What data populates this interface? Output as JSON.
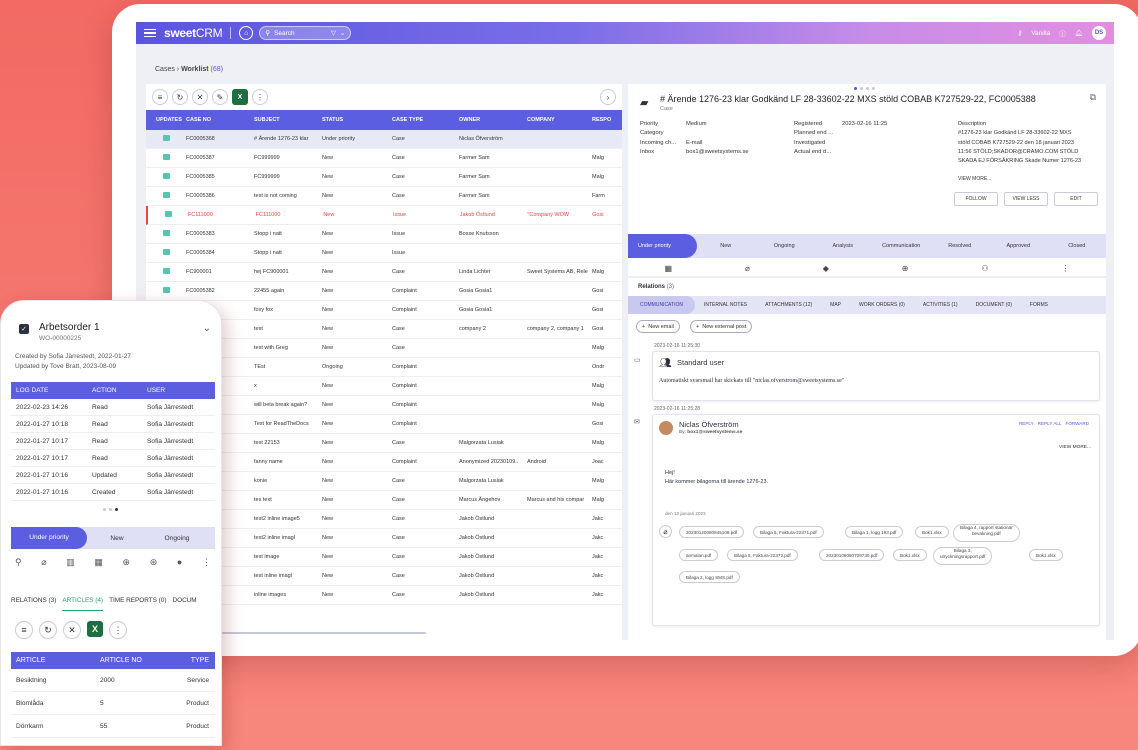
{
  "topbar": {
    "logo_bold": "sweet",
    "logo_light": "CRM",
    "search_placeholder": "Search",
    "user_name": "Vanilla",
    "avatar_initials": "DS"
  },
  "breadcrumb": {
    "root": "Cases",
    "current": "Worklist",
    "count": "(68)"
  },
  "list": {
    "columns": [
      "UPDATES",
      "CASE NO",
      "SUBJECT",
      "STATUS",
      "CASE TYPE",
      "OWNER",
      "COMPANY",
      "RESPO"
    ],
    "rows": [
      {
        "case": "FC0005368",
        "subject": "# Ärende 1276-23 klar",
        "status": "Under priority",
        "type": "Case",
        "owner": "Niclas Öfverström",
        "company": "",
        "resp": ""
      },
      {
        "case": "FC0005387",
        "subject": "FC999999",
        "status": "New",
        "type": "Case",
        "owner": "Farmer Sam",
        "company": "",
        "resp": "Malg"
      },
      {
        "case": "FC0005385",
        "subject": "FC999999",
        "status": "New",
        "type": "Case",
        "owner": "Farmer Sam",
        "company": "",
        "resp": "Malg"
      },
      {
        "case": "FC0005386",
        "subject": "test is not coming",
        "status": "New",
        "type": "Case",
        "owner": "Farmer Sam",
        "company": "",
        "resp": "Farm"
      },
      {
        "case": "FC111000",
        "subject": "FC111000",
        "status": "New",
        "type": "Issue",
        "owner": "Jakob Östlund",
        "company": "\"Company WOW",
        "resp": "Gosi"
      },
      {
        "case": "FC0005383",
        "subject": "Stopp i natt",
        "status": "New",
        "type": "Issue",
        "owner": "Bosse Knutsson",
        "company": "",
        "resp": ""
      },
      {
        "case": "FC0005384",
        "subject": "Stopp i natt",
        "status": "New",
        "type": "Issue",
        "owner": "",
        "company": "",
        "resp": ""
      },
      {
        "case": "FC900001",
        "subject": "hej FC900001",
        "status": "New",
        "type": "Case",
        "owner": "Linda Lichter",
        "company": "Sweet Systems AB, Rele",
        "resp": "Malg"
      },
      {
        "case": "FC0005382",
        "subject": "22455 again",
        "status": "New",
        "type": "Complaint",
        "owner": "Gosia Gosia1",
        "company": "",
        "resp": "Gosi"
      },
      {
        "case": "",
        "subject": "foxy fox",
        "status": "New",
        "type": "Complaint",
        "owner": "Gosia Gosia1",
        "company": "",
        "resp": "Gosi"
      },
      {
        "case": "",
        "subject": "test",
        "status": "New",
        "type": "Case",
        "owner": "company 2",
        "company": "company 2, company 1",
        "resp": "Gosi"
      },
      {
        "case": "",
        "subject": "test with Greg",
        "status": "New",
        "type": "Case",
        "owner": "",
        "company": "",
        "resp": "Malg"
      },
      {
        "case": "",
        "subject": "TEst",
        "status": "Ongoing",
        "type": "Complaint",
        "owner": "",
        "company": "",
        "resp": "Ondr"
      },
      {
        "case": "",
        "subject": "x",
        "status": "New",
        "type": "Complaint",
        "owner": "",
        "company": "",
        "resp": "Malg"
      },
      {
        "case": "",
        "subject": "will beta break again?",
        "status": "New",
        "type": "Complaint",
        "owner": "",
        "company": "",
        "resp": "Malg"
      },
      {
        "case": "",
        "subject": "Test for ReadTheDocs",
        "status": "New",
        "type": "Complaint",
        "owner": "",
        "company": "",
        "resp": "Gosi"
      },
      {
        "case": "",
        "subject": "test 22153",
        "status": "New",
        "type": "Case",
        "owner": "Malgorzata Lusiak",
        "company": "",
        "resp": "Malg"
      },
      {
        "case": "",
        "subject": "fanny name",
        "status": "New",
        "type": "Complaint",
        "owner": "Anonymized 20230109..",
        "company": "Android",
        "resp": "Joac"
      },
      {
        "case": "",
        "subject": "konie",
        "status": "New",
        "type": "Case",
        "owner": "Malgorzata Lusiak",
        "company": "",
        "resp": "Malg"
      },
      {
        "case": "",
        "subject": "tes text",
        "status": "New",
        "type": "Case",
        "owner": "Marcus Ängehov",
        "company": "Marcus and his compar",
        "resp": "Malg"
      },
      {
        "case": "",
        "subject": "test2 inline image5",
        "status": "New",
        "type": "Case",
        "owner": "Jakob Östlund",
        "company": "",
        "resp": "Jakc"
      },
      {
        "case": "",
        "subject": "test2 inline imagl",
        "status": "New",
        "type": "Case",
        "owner": "Jakob Östlund",
        "company": "",
        "resp": "Jakc"
      },
      {
        "case": "",
        "subject": "test image",
        "status": "New",
        "type": "Case",
        "owner": "Jakob Östlund",
        "company": "",
        "resp": "Jakc"
      },
      {
        "case": "",
        "subject": "test inline imagl",
        "status": "New",
        "type": "Case",
        "owner": "Jakob Östlund",
        "company": "",
        "resp": "Jakc"
      },
      {
        "case": "",
        "subject": "inline images",
        "status": "New",
        "type": "Case",
        "owner": "Jakob Östlund",
        "company": "",
        "resp": "Jakc"
      }
    ]
  },
  "detail": {
    "title": "# Ärende 1276-23 klar Godkänd LF 28-33602-22 MXS stöld COBAB K727529-22, FC0005388",
    "subtitle": "Case",
    "fields_left": [
      [
        "Priority",
        "Medium"
      ],
      [
        "Category",
        ""
      ],
      [
        "Incoming ch...",
        "E-mail"
      ],
      [
        "Inbox",
        "box1@sweetsystems.se"
      ]
    ],
    "fields_mid": [
      [
        "Registered",
        "2023-02-16 11:25"
      ],
      [
        "Planned end ...",
        ""
      ],
      [
        "Investigated",
        ""
      ],
      [
        "Actual end d...",
        ""
      ]
    ],
    "description_label": "Description",
    "description": [
      "#1276-23 klar Godkänd LF 28-33602-22 MXS",
      "stöld COBAB K727529-22 den 18 januari 2023",
      "11:56 STÖLD;SKADOR@CRAMO.COM      STÖLD",
      "SKADA  EJ FÖRSÄKRING  Skade Numer 1276-23"
    ],
    "view_more": "VIEW MORE...",
    "buttons": {
      "follow": "FOLLOW",
      "view_less": "VIEW LESS",
      "edit": "EDIT"
    },
    "stages": [
      "Under priority",
      "New",
      "Ongoing",
      "Analysis",
      "Communication",
      "Resolved",
      "Approved",
      "Closed"
    ]
  },
  "relations": {
    "title": "Relations",
    "count": "(3)",
    "tabs": [
      "COMMUNICATION",
      "INTERNAL NOTES",
      "ATTACHMENTS (12)",
      "MAP",
      "WORK ORDERS (0)",
      "ACTIVITIES (1)",
      "DOCUMENT (0)",
      "FORMS"
    ],
    "new_email": "New email",
    "new_external_post": "New external post",
    "entry1": {
      "stamp": "2023-02-16 11:25:30",
      "user": "Standard user",
      "text": "Automatiskt svarsmail har skickats till \"niclas.ofverstrom@sweetsystems.se\""
    },
    "entry2": {
      "stamp": "2023-02-16 11:25:28",
      "user": "Niclas Öfverström",
      "by": "By:",
      "by_email": "box1@sweetsystems.se",
      "actions": [
        "REPLY",
        "REPLY ALL",
        "FORWARD"
      ],
      "view_more": "VIEW MORE...",
      "greeting": "Hej!",
      "body": "Här kommer bilagorna till ärende 1276-23.",
      "date": "den 13 januari 2023"
    },
    "attachments": [
      "20230120080845108.pdf",
      "Bilaga 5, Faktura-22371.pdf",
      "Bilaga 1, logg 193.pdf",
      "Bok1.xlsx",
      "Bilaga 4, rapport stationär",
      "bevakning.pdf",
      "anmalan.pdf",
      "Bilaga 5, Faktura-22372.pdf",
      "20230108080709730.pdf",
      "Bok1.xlsx",
      "Bilaga 3,",
      "utryckningsrapport.pdf",
      "Bok1.xlsx",
      "Bilaga 2, logg SMS.pdf"
    ]
  },
  "phone": {
    "title": "Arbetsorder 1",
    "wo": "WO-00000225",
    "created": "Created by Sofia Järrestedt, 2022-01-27",
    "updated": "Updated by Tove Bratt, 2023-08-09",
    "log_columns": [
      "LOG DATE",
      "ACTION",
      "USER"
    ],
    "log_rows": [
      [
        "2022-02-23 14:26",
        "Read",
        "Sofia Järrestedt"
      ],
      [
        "2022-01-27 10:18",
        "Read",
        "Sofia Järrestedt"
      ],
      [
        "2022-01-27 10:17",
        "Read",
        "Sofia Järrestedt"
      ],
      [
        "2022-01-27 10:17",
        "Read",
        "Sofia Järrestedt"
      ],
      [
        "2022-01-27 10:16",
        "Updated",
        "Sofia Järrestedt"
      ],
      [
        "2022-01-27 10:16",
        "Created",
        "Sofia Järrestedt"
      ]
    ],
    "stages": [
      "Under priority",
      "New",
      "Ongoing"
    ],
    "tabs": [
      "RELATIONS (3)",
      "ARTICLES (4)",
      "TIME REPORTS (0)",
      "DOCUM"
    ],
    "article_columns": [
      "ARTICLE",
      "ARTICLE NO",
      "TYPE"
    ],
    "article_rows": [
      [
        "Besiktning",
        "2000",
        "Service"
      ],
      [
        "Blomlåda",
        "5",
        "Product"
      ],
      [
        "Dörrkarm",
        "55",
        "Product"
      ]
    ]
  }
}
